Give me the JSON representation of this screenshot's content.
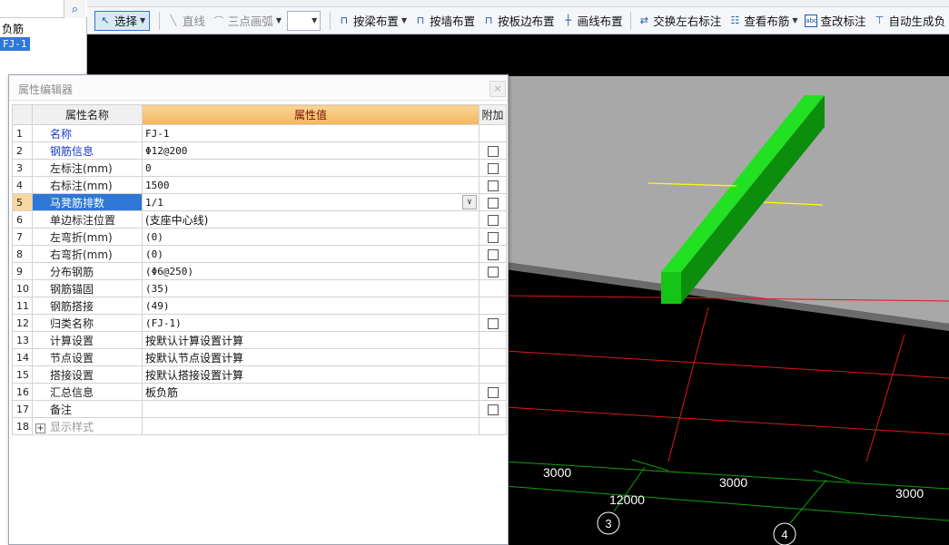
{
  "tree": {
    "items": [
      "负筋",
      "FJ-1"
    ],
    "search_icon": "search-icon"
  },
  "toolbar": {
    "select_label": "选择",
    "line_label": "直线",
    "arc_label": "三点画弧",
    "combo_value": "",
    "beam_label": "按梁布置",
    "wall_label": "按墙布置",
    "slab_edge_label": "按板边布置",
    "draw_line_label": "画线布置",
    "swap_label": "交换左右标注",
    "view_rebar_label": "查看布筋",
    "check_label": "查改标注",
    "auto_label": "自动生成负"
  },
  "editor": {
    "title": "属性编辑器",
    "close_label": "×",
    "col_name": "属性名称",
    "col_value": "属性值",
    "col_add": "附加",
    "rows": [
      {
        "n": "1",
        "name": "名称",
        "value": "FJ-1",
        "blue": true,
        "check": false
      },
      {
        "n": "2",
        "name": "钢筋信息",
        "value": "Φ12@200",
        "blue": true,
        "check": true
      },
      {
        "n": "3",
        "name": "左标注(mm)",
        "value": "0",
        "blue": false,
        "check": true
      },
      {
        "n": "4",
        "name": "右标注(mm)",
        "value": "1500",
        "blue": false,
        "check": true
      },
      {
        "n": "5",
        "name": "马凳筋排数",
        "value": "1/1",
        "blue": false,
        "check": true,
        "current": true
      },
      {
        "n": "6",
        "name": "单边标注位置",
        "value": "(支座中心线)",
        "blue": false,
        "check": true
      },
      {
        "n": "7",
        "name": "左弯折(mm)",
        "value": "(0)",
        "blue": false,
        "check": true
      },
      {
        "n": "8",
        "name": "右弯折(mm)",
        "value": "(0)",
        "blue": false,
        "check": true
      },
      {
        "n": "9",
        "name": "分布钢筋",
        "value": "(Φ6@250)",
        "blue": false,
        "check": true
      },
      {
        "n": "10",
        "name": "钢筋锚固",
        "value": "(35)",
        "blue": false,
        "check": false
      },
      {
        "n": "11",
        "name": "钢筋搭接",
        "value": "(49)",
        "blue": false,
        "check": false
      },
      {
        "n": "12",
        "name": "归类名称",
        "value": "(FJ-1)",
        "blue": false,
        "check": true
      },
      {
        "n": "13",
        "name": "计算设置",
        "value": "按默认计算设置计算",
        "blue": false,
        "check": false
      },
      {
        "n": "14",
        "name": "节点设置",
        "value": "按默认节点设置计算",
        "blue": false,
        "check": false
      },
      {
        "n": "15",
        "name": "搭接设置",
        "value": "按默认搭接设置计算",
        "blue": false,
        "check": false
      },
      {
        "n": "16",
        "name": "汇总信息",
        "value": "板负筋",
        "blue": false,
        "check": true
      },
      {
        "n": "17",
        "name": "备注",
        "value": "",
        "blue": false,
        "check": true
      },
      {
        "n": "18",
        "name": "显示样式",
        "value": "",
        "blue": false,
        "check": false,
        "expander": true,
        "grey": true
      }
    ]
  },
  "viewport": {
    "dims": [
      "3000",
      "3000",
      "3000",
      "12000"
    ],
    "axis_labels": [
      "3",
      "4"
    ],
    "colors": {
      "slab": "#a8a8a8",
      "rebar": "#22e022",
      "grid": "#e01818",
      "dimline": "#10a010",
      "marker": "#ffff00"
    }
  }
}
